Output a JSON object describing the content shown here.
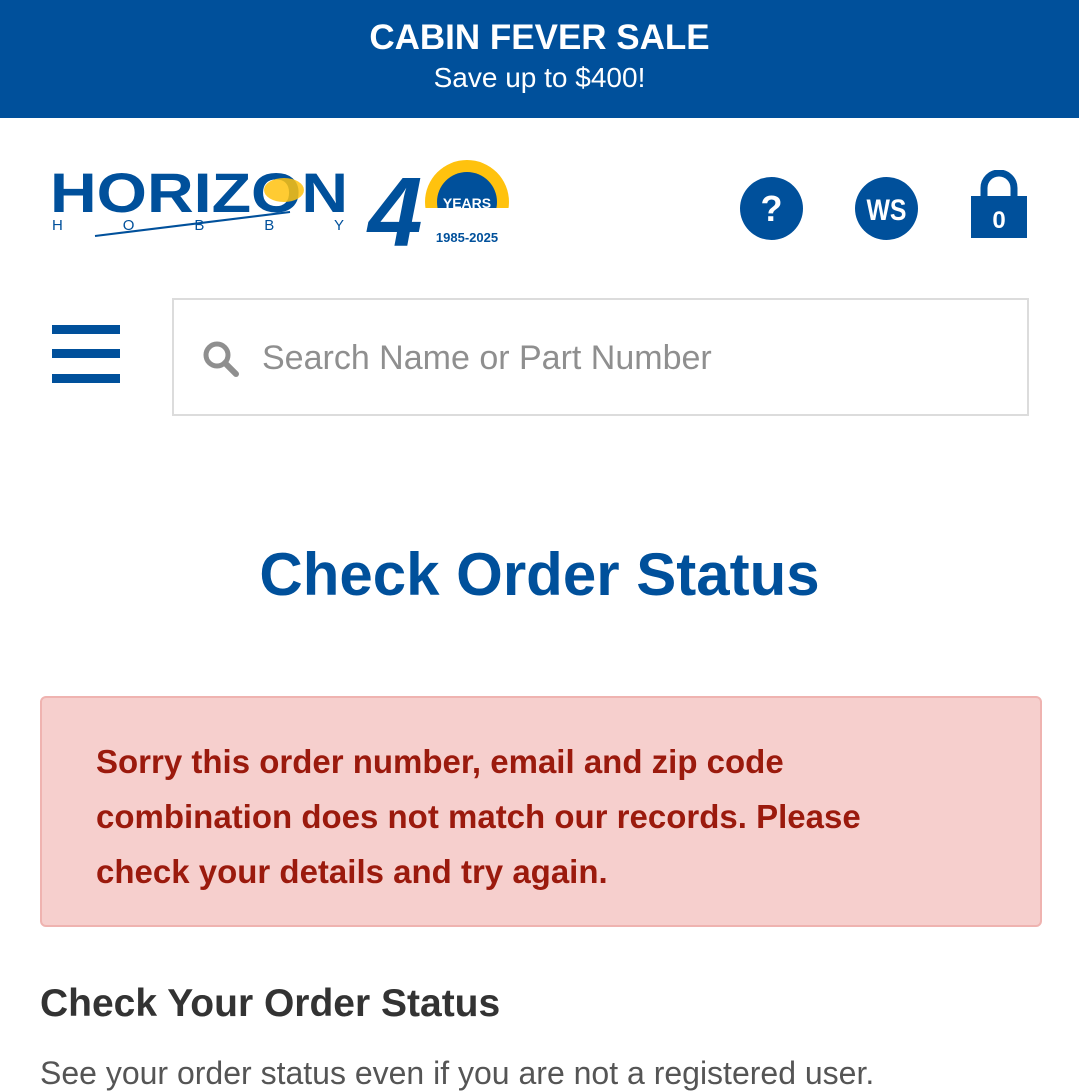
{
  "promo": {
    "title": "CABIN FEVER SALE",
    "subtitle": "Save up to $400!",
    "background": "#00509b"
  },
  "header": {
    "logo": {
      "brand": "HORIZON",
      "sub": "H O B B Y",
      "anniversary_number": "40",
      "anniversary_label": "YEARS",
      "anniversary_range": "1985-2025"
    },
    "help_icon": "question-circle-icon",
    "help_label": "?",
    "account_label": "WS",
    "cart_icon": "shopping-bag-icon",
    "cart_count": "0"
  },
  "search": {
    "icon": "search-icon",
    "placeholder": "Search Name or Part Number",
    "value": ""
  },
  "menu_icon": "hamburger-menu-icon",
  "page": {
    "title": "Check Order Status",
    "alert_message": "Sorry this order number, email and zip code combination does not match our records. Please check your details and try again.",
    "section_title": "Check Your Order Status",
    "section_text": "See your order status even if you are not a registered user."
  },
  "colors": {
    "brand_blue": "#00509b",
    "accent_yellow": "#ffc20e",
    "alert_background": "#f6cfcd",
    "alert_text": "#9b1a0d"
  }
}
